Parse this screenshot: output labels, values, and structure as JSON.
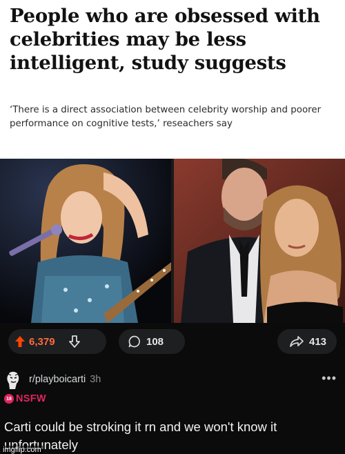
{
  "article": {
    "headline": "People who are obsessed with celebrities may be less intelligent, study suggests",
    "standfirst": "‘There is a direct association between celebrity worship and poorer performance on cognitive tests,’ reseachers say"
  },
  "post_actions": {
    "upvote_icon": "arrow-up",
    "downvote_icon": "arrow-down",
    "comment_icon": "speech-bubble",
    "share_icon": "share-arrow",
    "vote_count": "6,379",
    "comment_count": "108",
    "share_count": "413",
    "accent_color": "#ff4500"
  },
  "comment": {
    "subreddit": "r/playboicarti",
    "age": "3h",
    "more_icon": "more-dots",
    "nsfw_label": "NSFW",
    "nsfw_badge_text": "18",
    "nsfw_color": "#e0245e",
    "body": "Carti could be stroking it rn and we won't know it unfortunately"
  },
  "watermark": {
    "text": "imgflip.com"
  }
}
